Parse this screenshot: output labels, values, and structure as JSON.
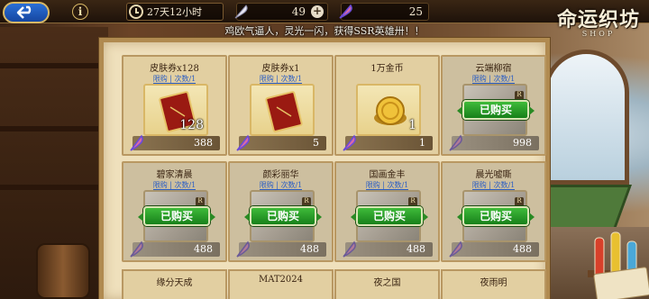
{
  "topbar": {
    "timer": "27天12小时",
    "currency_feather": "49",
    "currency_rainbow": "25",
    "logo_title": "命运织坊",
    "logo_sub": "SHOP"
  },
  "announcement": "鸡欧气逼人，灵光一闪，获得SSR英雄卅！！",
  "items": [
    {
      "title": "皮肤券x128",
      "tags": "限购 | 次数/1",
      "count": "128",
      "price": "388",
      "sold": false,
      "kind": "ticket"
    },
    {
      "title": "皮肤券x1",
      "tags": "限购 | 次数/1",
      "count": "",
      "price": "5",
      "sold": false,
      "kind": "ticket"
    },
    {
      "title": "1万金币",
      "tags": "",
      "count": "1",
      "price": "1",
      "sold": false,
      "kind": "coin"
    },
    {
      "title": "云端柳宿",
      "tags": "限购 | 次数/1",
      "count": "",
      "price": "998",
      "sold": true,
      "kind": "skin"
    },
    {
      "title": "碧家清晨",
      "tags": "限购 | 次数/1",
      "count": "",
      "price": "488",
      "sold": true,
      "kind": "skin"
    },
    {
      "title": "颜彩丽华",
      "tags": "限购 | 次数/1",
      "count": "",
      "price": "488",
      "sold": true,
      "kind": "skin"
    },
    {
      "title": "国画金丰",
      "tags": "限购 | 次数/1",
      "count": "",
      "price": "488",
      "sold": true,
      "kind": "skin"
    },
    {
      "title": "晨光嘘嘶",
      "tags": "限购 | 次数/1",
      "count": "",
      "price": "488",
      "sold": true,
      "kind": "skin"
    }
  ],
  "row3_titles": [
    "缘分天成",
    "MAT2024",
    "夜之国",
    "夜雨明"
  ],
  "bought_label": "已购买",
  "colors": {
    "bought_green": "#2a9a24",
    "panel_bg": "#efe0bc",
    "border_gold": "#b08a50"
  }
}
